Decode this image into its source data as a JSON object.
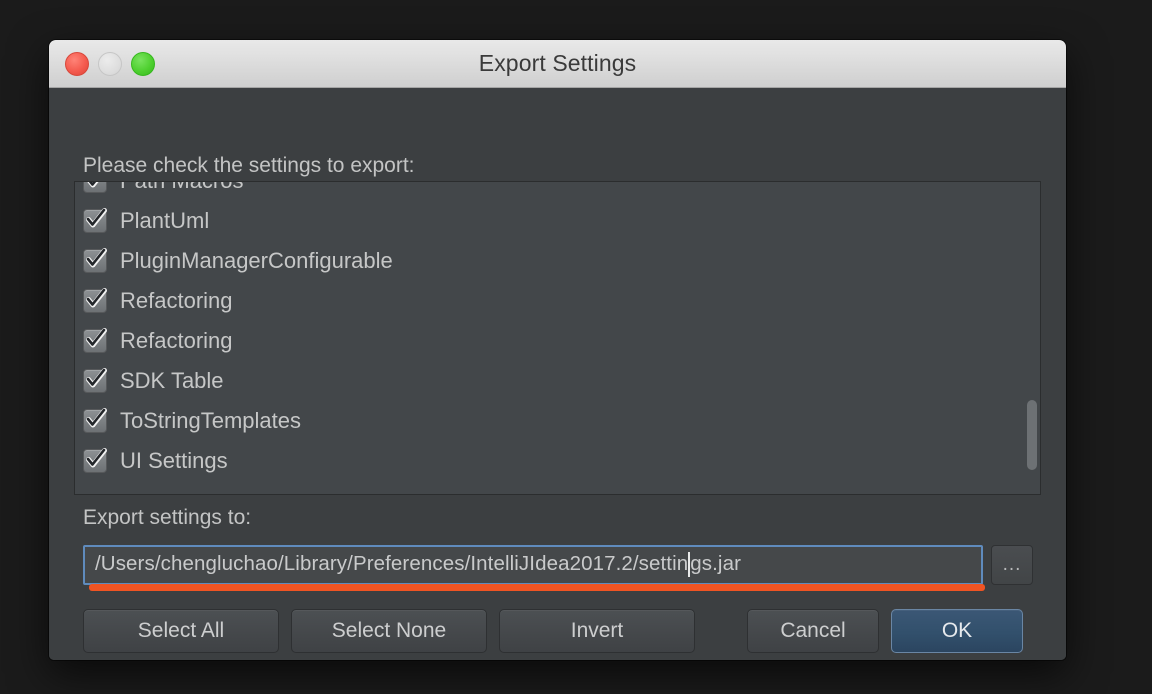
{
  "window": {
    "title": "Export Settings",
    "traffic_lights": [
      {
        "name": "close",
        "color": "#f45b4f",
        "enabled": true
      },
      {
        "name": "minimize",
        "color": "#dedede",
        "enabled": false
      },
      {
        "name": "maximize",
        "color": "#4fd030",
        "enabled": true
      }
    ]
  },
  "dialog": {
    "prompt": "Please check the settings to export:",
    "export_label": "Export settings to:"
  },
  "settings_list": {
    "items": [
      {
        "label": "Path Macros",
        "checked": true
      },
      {
        "label": "PlantUml",
        "checked": true
      },
      {
        "label": "PluginManagerConfigurable",
        "checked": true
      },
      {
        "label": "Refactoring",
        "checked": true
      },
      {
        "label": "Refactoring",
        "checked": true
      },
      {
        "label": "SDK Table",
        "checked": true
      },
      {
        "label": "ToStringTemplates",
        "checked": true
      },
      {
        "label": "UI Settings",
        "checked": true
      }
    ],
    "scroll_position": "bottom"
  },
  "path_input": {
    "value_before_caret": "/Users/chengluchao/Library/Preferences/IntelliJIdea2017.2/settin",
    "value_after_caret": "gs.jar",
    "full_value": "/Users/chengluchao/Library/Preferences/IntelliJIdea2017.2/settings.jar",
    "browse_label": "...",
    "focused": true
  },
  "buttons": {
    "select_all": "Select All",
    "select_none": "Select None",
    "invert": "Invert",
    "cancel": "Cancel",
    "ok": "OK"
  },
  "annotations": {
    "color": "#f05423",
    "targets": [
      "path-input-underline",
      "ok-button-underline"
    ]
  }
}
